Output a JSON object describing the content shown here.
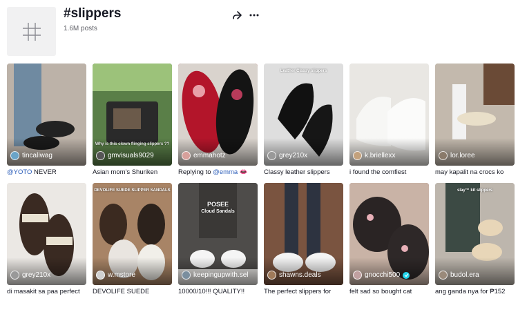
{
  "tag": {
    "title": "#slippers",
    "posts": "1.6M posts"
  },
  "icons": {
    "share": "share-icon",
    "more": "more-icon",
    "hashtag": "hashtag-icon",
    "verified": "verified-badge-icon"
  },
  "colors": {
    "mention": "#2b5db9",
    "verified": "#20d5ec"
  },
  "videos": [
    {
      "author": "tincaliwag",
      "caption_mention": "@YOTO",
      "caption": " NEVER",
      "bg": "#b9aea6"
    },
    {
      "author": "gmvisuals9029",
      "caption": "Asian mom's Shuriken",
      "overlay": "Why is this clown flinging slippers ??",
      "bg": "#4e6b3f"
    },
    {
      "author": "emmahotz",
      "caption": "Replying to ",
      "caption_mention": "@emma",
      "caption_after": " 👄",
      "bg": "#9e1f2a"
    },
    {
      "author": "grey210x",
      "caption": "Classy leather slippers",
      "overlay": "Leather Classy slippers",
      "bg": "#d9d9d9"
    },
    {
      "author": "k.briellexx",
      "caption": "i found the comfiest",
      "bg": "#e8e6e1"
    },
    {
      "author": "lor.loree",
      "caption": "may kapalit na crocs ko",
      "bg": "#b5aca0"
    },
    {
      "author": "grey210x",
      "caption": "di masakit sa paa perfect",
      "bg": "#e6e3df"
    },
    {
      "author": "w.mstore",
      "caption": "DEVOLIFE SUEDE",
      "overlay": "DEVOLIFE SUEDE SLIPPER SANDALS",
      "bg": "#8d6a4e"
    },
    {
      "author": "keepingupwith.sel",
      "caption": "10000/10!!! QUALITY!!",
      "overlay": "POSEE",
      "overlay2": "Cloud Sandals",
      "bg": "#5d5a58"
    },
    {
      "author": "shawns.deals",
      "caption": "The perfect slippers for",
      "bg": "#6f4a35"
    },
    {
      "author": "gnocchi500",
      "caption": "felt sad so bought cat",
      "verified": true,
      "bg": "#6f3b3b"
    },
    {
      "author": "budol.era",
      "caption": "ang ganda nya for ₱152",
      "overlay": "slay™ kit slippers",
      "bg": "#b7b0a8"
    }
  ]
}
